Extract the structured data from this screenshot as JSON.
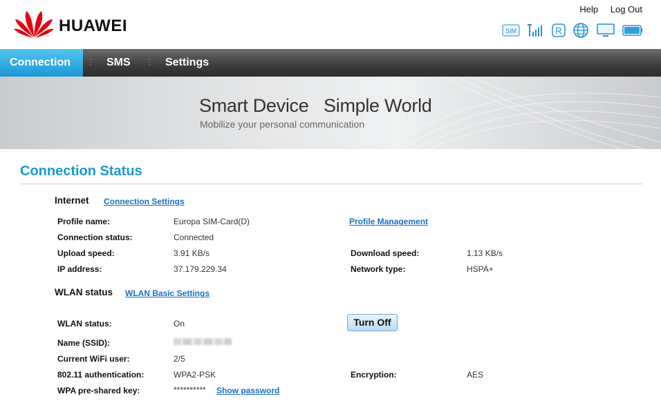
{
  "header": {
    "brand": "HUAWEI",
    "links": {
      "help": "Help",
      "logout": "Log Out"
    },
    "status_icons": [
      "sim-icon",
      "signal-icon",
      "roaming-icon",
      "globe-icon",
      "monitor-icon",
      "battery-icon"
    ],
    "sim_label": "SIM",
    "roaming_label": "R"
  },
  "nav": {
    "connection": "Connection",
    "sms": "SMS",
    "settings": "Settings"
  },
  "banner": {
    "title": "Smart Device   Simple World",
    "subtitle": "Mobilize your personal communication"
  },
  "page_title": "Connection Status",
  "internet": {
    "heading": "Internet",
    "settings_link": "Connection Settings",
    "profile_mgmt_link": "Profile Management",
    "profile_name_label": "Profile name:",
    "profile_name": "Europa SIM-Card(D)",
    "conn_status_label": "Connection status:",
    "conn_status": "Connected",
    "upload_label": "Upload speed:",
    "upload": "3.91 KB/s",
    "download_label": "Download speed:",
    "download": "1.13 KB/s",
    "ip_label": "IP address:",
    "ip": "37.179.229.34",
    "nettype_label": "Network type:",
    "nettype": "HSPA+"
  },
  "wlan": {
    "heading": "WLAN status",
    "settings_link": "WLAN Basic Settings",
    "status_label": "WLAN status:",
    "status": "On",
    "turn_off": "Turn Off",
    "ssid_label": "Name (SSID):",
    "users_label": "Current WiFi user:",
    "users": "2/5",
    "auth_label": "802.11 authentication:",
    "auth": "WPA2-PSK",
    "enc_label": "Encryption:",
    "enc": "AES",
    "psk_label": "WPA pre-shared key:",
    "psk": "**********",
    "show_password": "Show password"
  },
  "colors": {
    "accent": "#1a98cf",
    "nav_active": "#29a8e2",
    "link": "#1a6fc0",
    "logo_red": "#e60012"
  }
}
